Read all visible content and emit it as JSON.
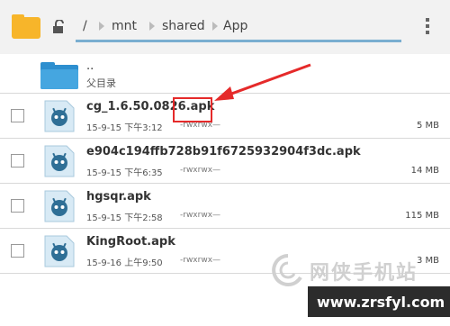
{
  "topbar": {
    "breadcrumbs": [
      "/",
      "mnt",
      "shared",
      "App"
    ]
  },
  "parent": {
    "dots": "..",
    "label": "父目录"
  },
  "files": [
    {
      "name": "cg_1.6.50.0826.apk",
      "date": "15-9-15 下午3:12",
      "perms": "-rwxrwx—",
      "size": "5 MB"
    },
    {
      "name": "e904c194ffb728b91f6725932904f3dc.apk",
      "date": "15-9-15 下午6:35",
      "perms": "-rwxrwx—",
      "size": "14 MB"
    },
    {
      "name": "hgsqr.apk",
      "date": "15-9-15 下午2:58",
      "perms": "-rwxrwx—",
      "size": "115 MB"
    },
    {
      "name": "KingRoot.apk",
      "date": "15-9-16 上午9:50",
      "perms": "-rwxrwx—",
      "size": "3 MB"
    }
  ],
  "watermark": {
    "brand": "网侠手机站",
    "url": "www.zrsfyl.com"
  },
  "colors": {
    "accent": "#7aaed0",
    "highlight": "#e52a2a",
    "folder": "#f7b52a",
    "apk_icon_bg": "#d8eaf5",
    "apk_robot": "#2f6f96"
  }
}
